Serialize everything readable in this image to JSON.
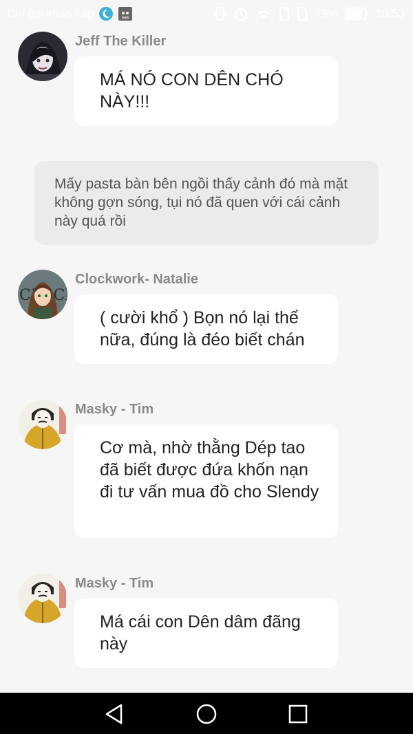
{
  "status_bar": {
    "carrier_text": "Chỉ gọi khẩn cấp",
    "battery_percent": "79%",
    "time": "10:53",
    "icons": [
      "moon-icon",
      "cat-app-icon",
      "vibrate-icon",
      "alarm-icon",
      "wifi-icon",
      "sim-icon",
      "sim-icon",
      "battery-icon"
    ]
  },
  "messages": [
    {
      "sender": "Jeff The Killer",
      "text": "MÁ NÓ CON DÊN CHÓ NÀY!!!",
      "avatar_icon": "dark-hair-avatar"
    },
    {
      "narration": "Mấy pasta bàn bên ngồi thấy cảnh đó mà mặt không gợn sóng, tụi nó đã quen với cái cảnh này quá rồi"
    },
    {
      "sender": "Clockwork- Natalie",
      "text": "( cười khổ ) Bọn nó lại thế nữa, đúng là đéo biết chán",
      "avatar_icon": "clockwork-avatar"
    },
    {
      "sender": "Masky - Tim",
      "text": "Cơ mà, nhờ thằng Dép tao đã biết được đứa khốn nạn đi tư vấn mua đồ cho Slendy",
      "avatar_icon": "masky-avatar"
    },
    {
      "sender": "Masky - Tim",
      "text": "Má cái con Dên dâm đãng này",
      "avatar_icon": "masky-avatar"
    }
  ],
  "nav_bar": {
    "buttons": [
      "back-icon",
      "home-icon",
      "recents-icon"
    ]
  }
}
